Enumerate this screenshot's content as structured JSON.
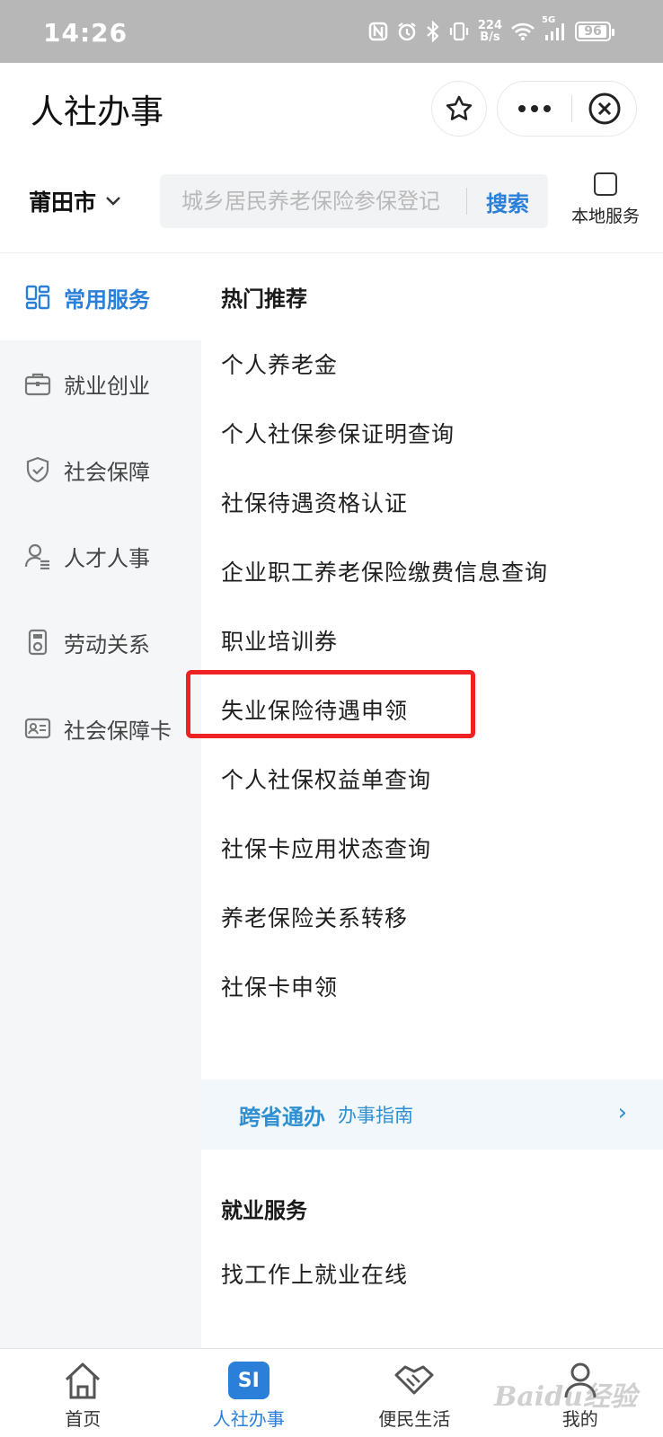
{
  "status_bar": {
    "time": "14:26",
    "net_speed_value": "224",
    "net_speed_unit": "B/s",
    "signal_label": "5G",
    "battery": "96"
  },
  "title_bar": {
    "title": "人社办事"
  },
  "search_row": {
    "city": "莆田市",
    "placeholder": "城乡居民养老保险参保登记",
    "search_label": "搜索",
    "local_service_label": "本地服务"
  },
  "sidebar": {
    "items": [
      {
        "label": "常用服务",
        "icon": "grid-icon",
        "active": true
      },
      {
        "label": "就业创业",
        "icon": "briefcase-icon",
        "active": false
      },
      {
        "label": "社会保障",
        "icon": "shield-icon",
        "active": false
      },
      {
        "label": "人才人事",
        "icon": "person-icon",
        "active": false
      },
      {
        "label": "劳动关系",
        "icon": "device-icon",
        "active": false
      },
      {
        "label": "社会保障卡",
        "icon": "id-card-icon",
        "active": false
      }
    ]
  },
  "content": {
    "hot_title": "热门推荐",
    "hot_items": [
      "个人养老金",
      "个人社保参保证明查询",
      "社保待遇资格认证",
      "企业职工养老保险缴费信息查询",
      "职业培训券",
      "失业保险待遇申领",
      "个人社保权益单查询",
      "社保卡应用状态查询",
      "养老保险关系转移",
      "社保卡申领"
    ],
    "cross_province": {
      "title": "跨省通办",
      "subtitle": "办事指南",
      "arrow": "›"
    },
    "employment_title": "就业服务",
    "employment_items": [
      "找工作上就业在线"
    ]
  },
  "tab_bar": {
    "tabs": [
      {
        "label": "首页",
        "icon": "home-icon"
      },
      {
        "label": "人社办事",
        "icon": "si-icon",
        "badge": "SI",
        "active": true
      },
      {
        "label": "便民生活",
        "icon": "handshake-icon"
      },
      {
        "label": "我的",
        "icon": "user-icon"
      }
    ]
  },
  "watermark": "Baidu经验",
  "colors": {
    "accent": "#2b7fd8",
    "highlight_border": "#ee2222",
    "status_bar": "#b7b7b7",
    "sidebar_bg": "#f5f6f8"
  }
}
